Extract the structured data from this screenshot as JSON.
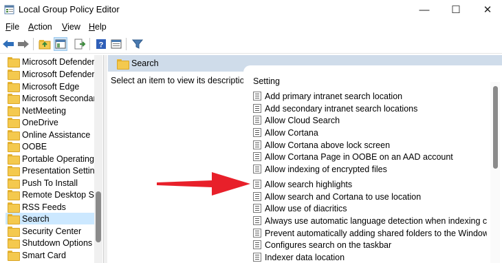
{
  "window": {
    "title": "Local Group Policy Editor",
    "controls": {
      "minimize": "—",
      "maximize": "☐",
      "close": "✕"
    }
  },
  "menu": {
    "items": [
      {
        "label": "File",
        "accel": "F",
        "rest": "ile"
      },
      {
        "label": "Action",
        "accel": "A",
        "rest": "ction"
      },
      {
        "label": "View",
        "accel": "V",
        "rest": "iew"
      },
      {
        "label": "Help",
        "accel": "H",
        "rest": "elp"
      }
    ]
  },
  "toolbar": {
    "icons": [
      "back-arrow-icon",
      "forward-arrow-icon",
      "up-folder-icon",
      "show-hide-tree-icon",
      "export-list-icon",
      "help-icon",
      "properties-icon",
      "filter-icon"
    ]
  },
  "tree": {
    "items": [
      {
        "label": "Microsoft Defender"
      },
      {
        "label": "Microsoft Defender"
      },
      {
        "label": "Microsoft Edge"
      },
      {
        "label": "Microsoft Secondary"
      },
      {
        "label": "NetMeeting"
      },
      {
        "label": "OneDrive"
      },
      {
        "label": "Online Assistance"
      },
      {
        "label": "OOBE"
      },
      {
        "label": "Portable Operating"
      },
      {
        "label": "Presentation Setting"
      },
      {
        "label": "Push To Install"
      },
      {
        "label": "Remote Desktop Ser"
      },
      {
        "label": "RSS Feeds"
      },
      {
        "label": "Search",
        "selected": true
      },
      {
        "label": "Security Center"
      },
      {
        "label": "Shutdown Options"
      },
      {
        "label": "Smart Card"
      }
    ]
  },
  "details": {
    "header_title": "Search",
    "description": "Select an item to view its description.",
    "column_header": "Setting",
    "settings": [
      {
        "label": "Add primary intranet search location"
      },
      {
        "label": "Add secondary intranet search locations"
      },
      {
        "label": "Allow Cloud Search"
      },
      {
        "label": "Allow Cortana"
      },
      {
        "label": "Allow Cortana above lock screen"
      },
      {
        "label": "Allow Cortana Page in OOBE on an AAD account"
      },
      {
        "label": "Allow indexing of encrypted files"
      },
      {
        "label": "Allow search highlights"
      },
      {
        "label": "Allow search and Cortana to use location"
      },
      {
        "label": "Allow use of diacritics"
      },
      {
        "label": "Always use automatic language detection when indexing con..."
      },
      {
        "label": "Prevent automatically adding shared folders to the Windows ..."
      },
      {
        "label": "Configures search on the taskbar"
      },
      {
        "label": "Indexer data location"
      }
    ]
  },
  "annotation": {
    "arrow_color": "#e8202a"
  }
}
